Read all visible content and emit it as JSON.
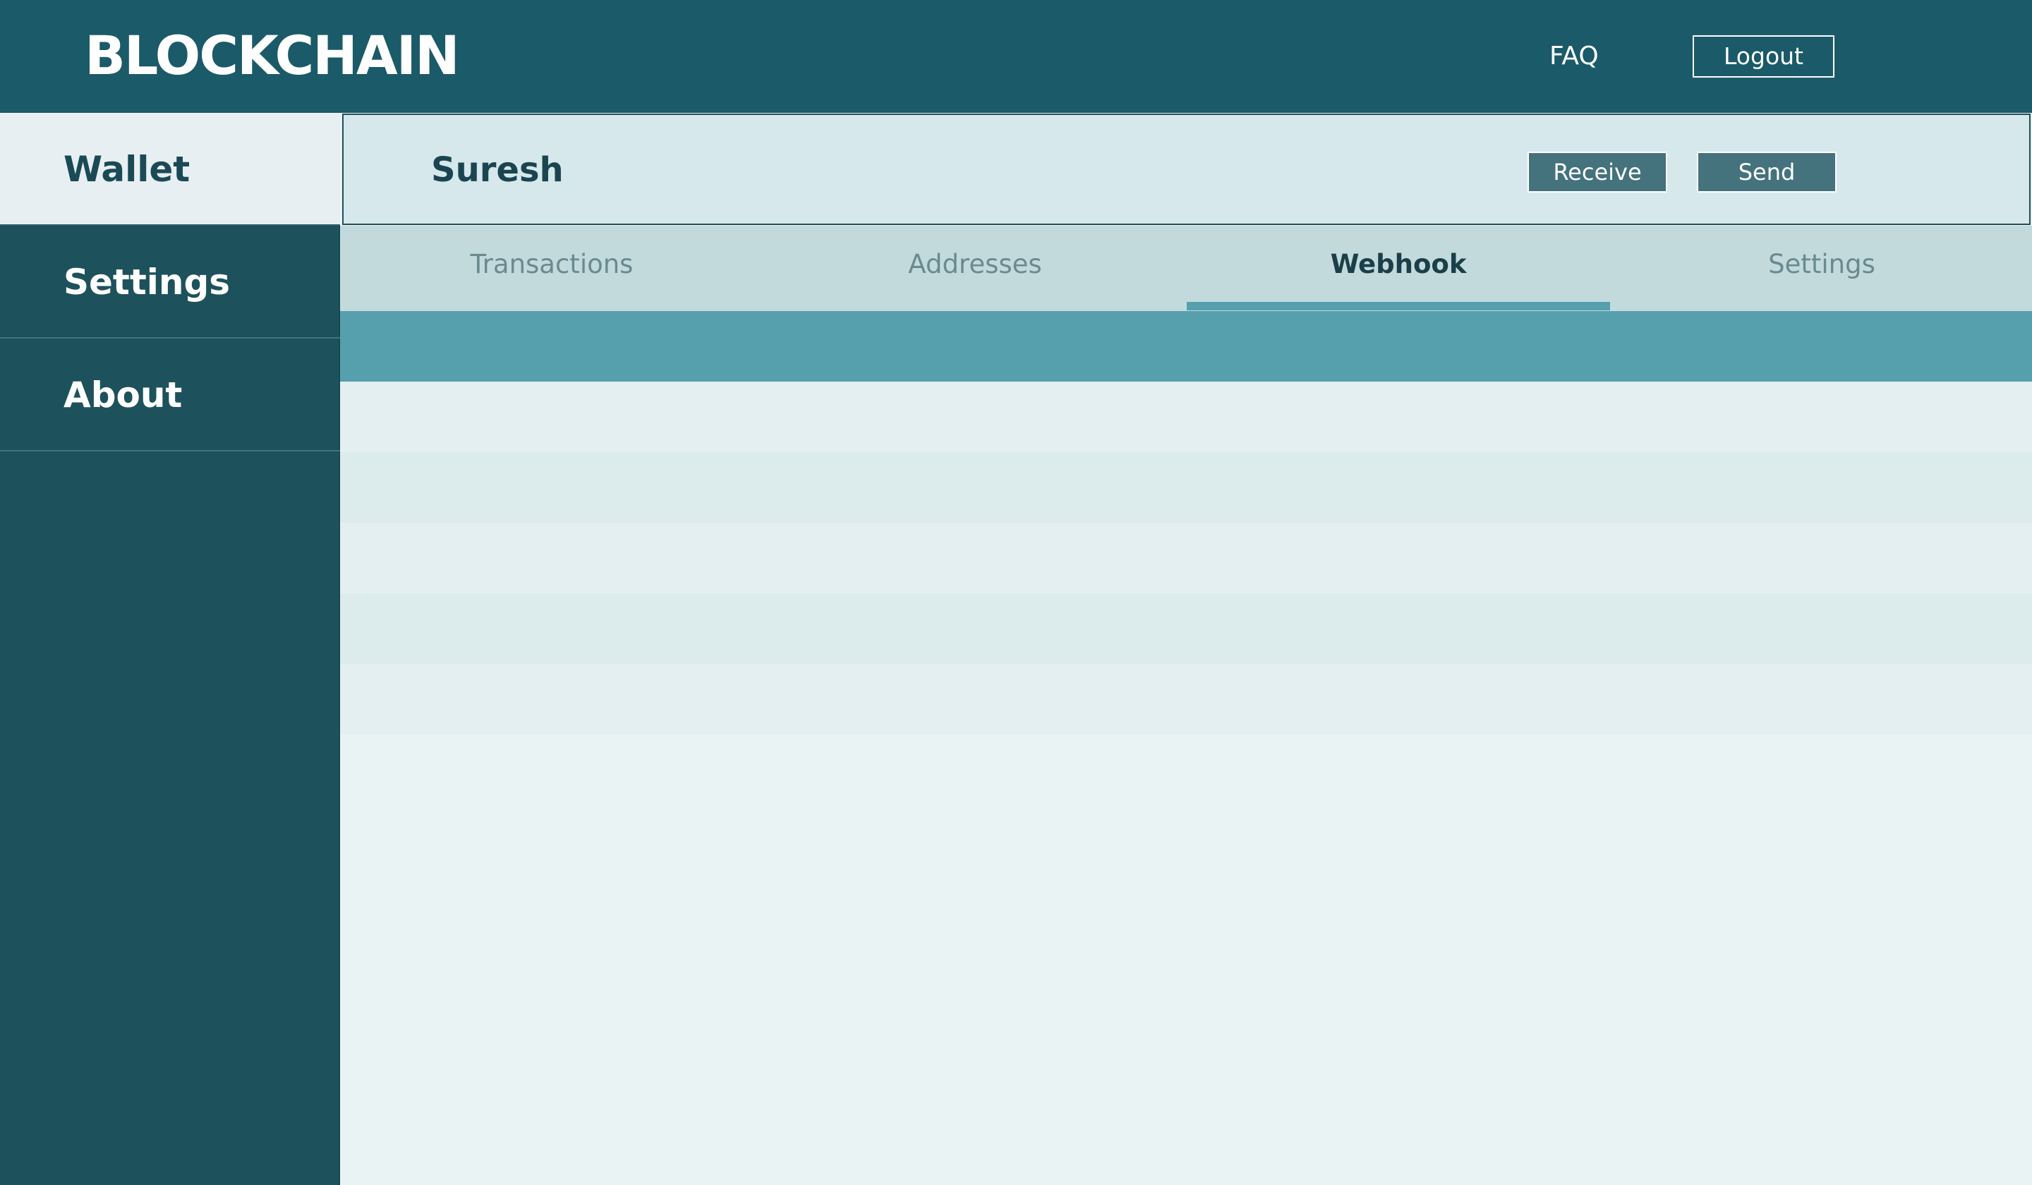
{
  "header": {
    "brand": "BLOCKCHAIN",
    "faq_label": "FAQ",
    "logout_label": "Logout"
  },
  "sidebar": {
    "items": [
      {
        "label": "Wallet",
        "active": true
      },
      {
        "label": "Settings",
        "active": false
      },
      {
        "label": "About",
        "active": false
      }
    ]
  },
  "wallet": {
    "user_name": "Suresh",
    "receive_label": "Receive",
    "send_label": "Send"
  },
  "tabs": [
    {
      "label": "Transactions",
      "active": false
    },
    {
      "label": "Addresses",
      "active": false
    },
    {
      "label": "Webhook",
      "active": true
    },
    {
      "label": "Settings",
      "active": false
    }
  ],
  "colors": {
    "primary": "#1b5a68",
    "sidebar": "#1d525c",
    "accent": "#569fad",
    "button": "#44727d"
  }
}
